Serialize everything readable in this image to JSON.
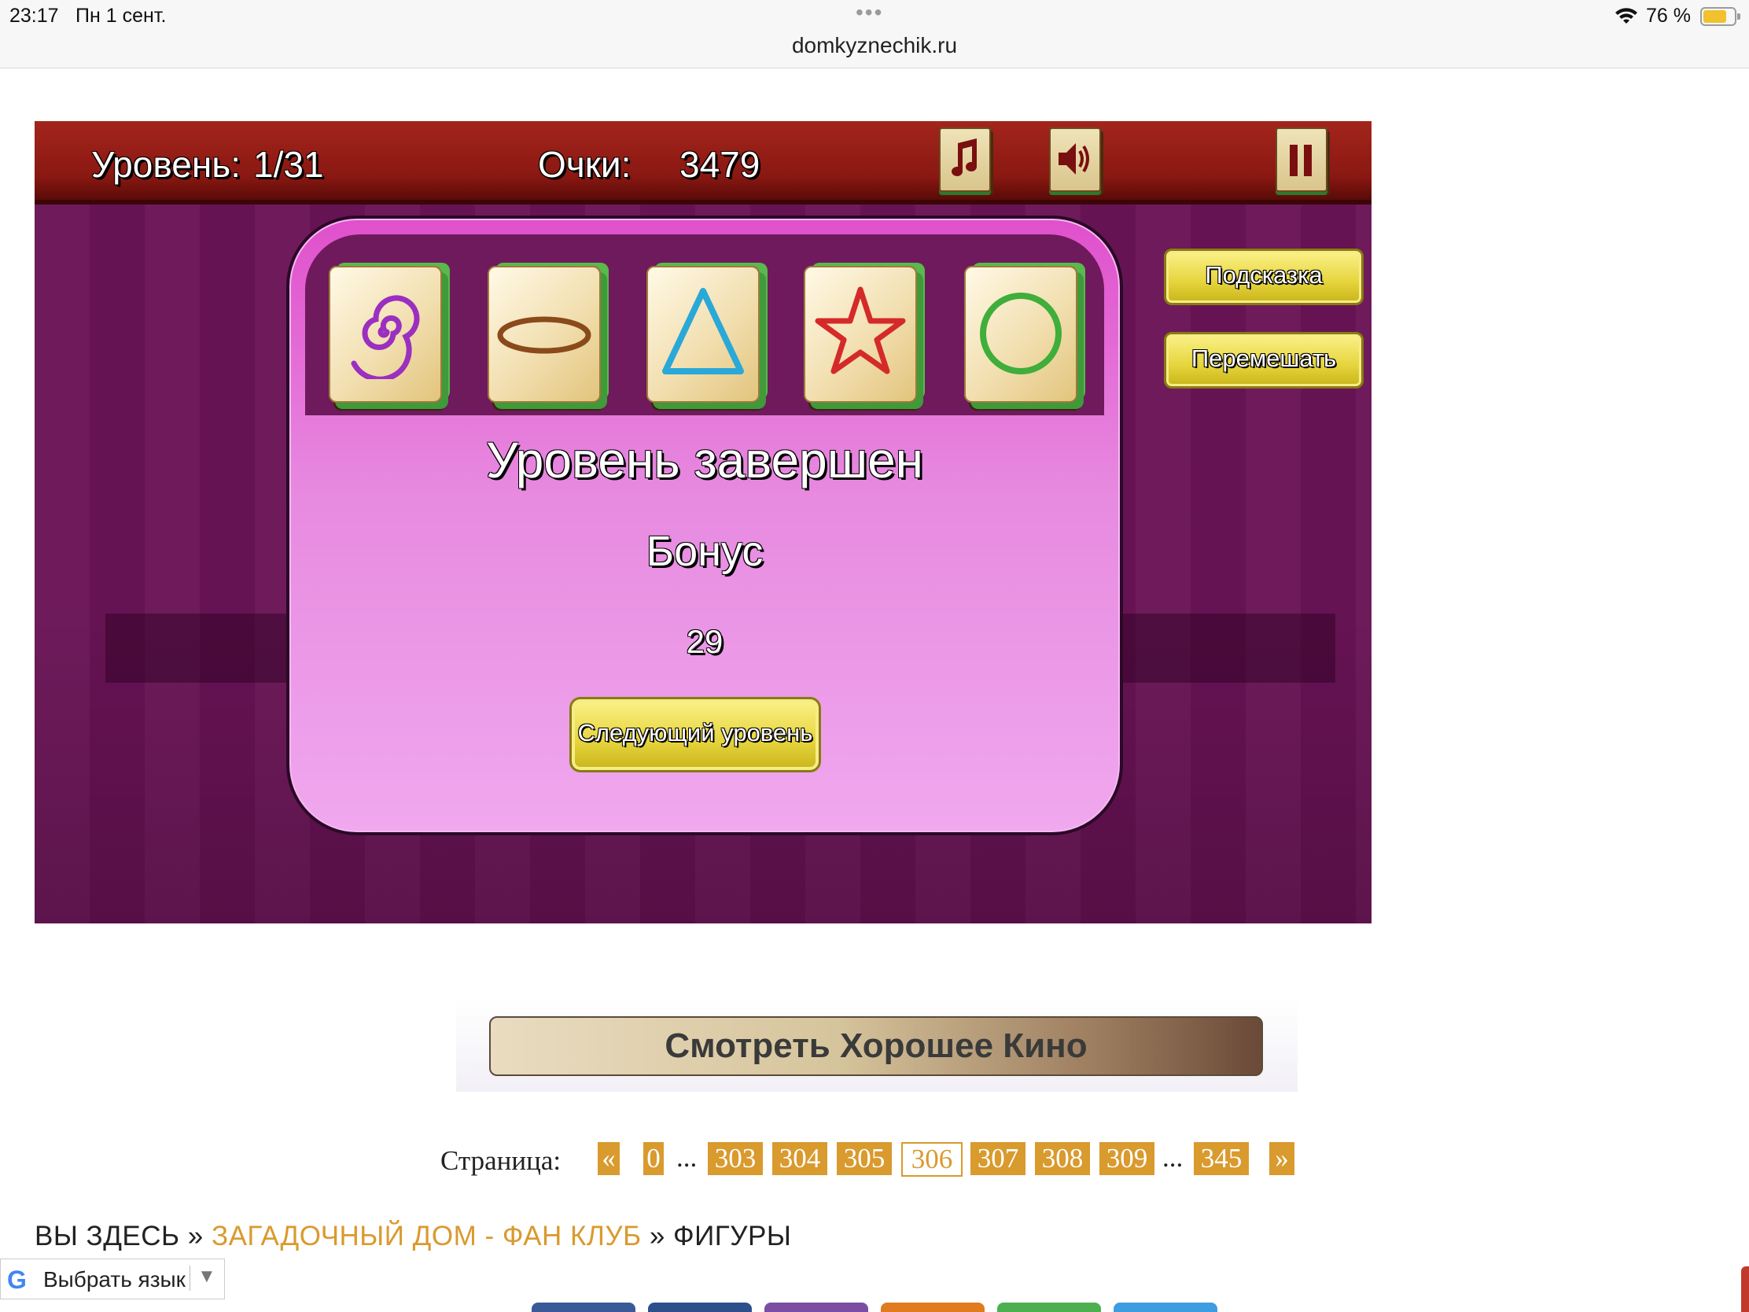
{
  "status_bar": {
    "time": "23:17",
    "date": "Пн 1 сент.",
    "battery": "76 %",
    "battery_level": 0.76,
    "url": "domkyznechik.ru"
  },
  "game": {
    "level_label": "Уровень:",
    "level_value": "1/31",
    "score_label": "Очки:",
    "score_value": "3479",
    "icons": [
      "music-icon",
      "speaker-icon",
      "pause-icon"
    ],
    "hint_label": "Подсказка",
    "shuffle_label": "Перемешать",
    "tiles": [
      "spiral",
      "oval",
      "triangle",
      "star",
      "circle"
    ],
    "dialog_title": "Уровень завершен",
    "bonus_label": "Бонус",
    "bonus_value": "29",
    "next_level_label": "Следующий уровень",
    "colors": {
      "bar": "#8a1812",
      "background": "#6a1456",
      "dialog": "#e78ae0",
      "button": "#e6d43c"
    }
  },
  "banner": {
    "label": "Смотреть Хорошее Кино"
  },
  "pagination": {
    "label": "Страница:",
    "prev": "«",
    "next": "»",
    "pages": [
      "0",
      "303",
      "304",
      "305",
      "306",
      "307",
      "308",
      "309",
      "345"
    ],
    "ellipsis": "...",
    "current": "306"
  },
  "breadcrumb": {
    "you_are_here": "ВЫ ЗДЕСЬ",
    "sep": "»",
    "parent": "ЗАГАДОЧНЫЙ ДОМ - ФАН КЛУБ",
    "current": "ФИГУРЫ"
  },
  "translate": {
    "logo": "G",
    "label": "Выбрать язык",
    "arrow": "▼"
  },
  "share_colors": [
    "#3b5998",
    "#2d4f8c",
    "#7b4ea3",
    "#e07b1f",
    "#4caf50",
    "#3d9de0"
  ]
}
